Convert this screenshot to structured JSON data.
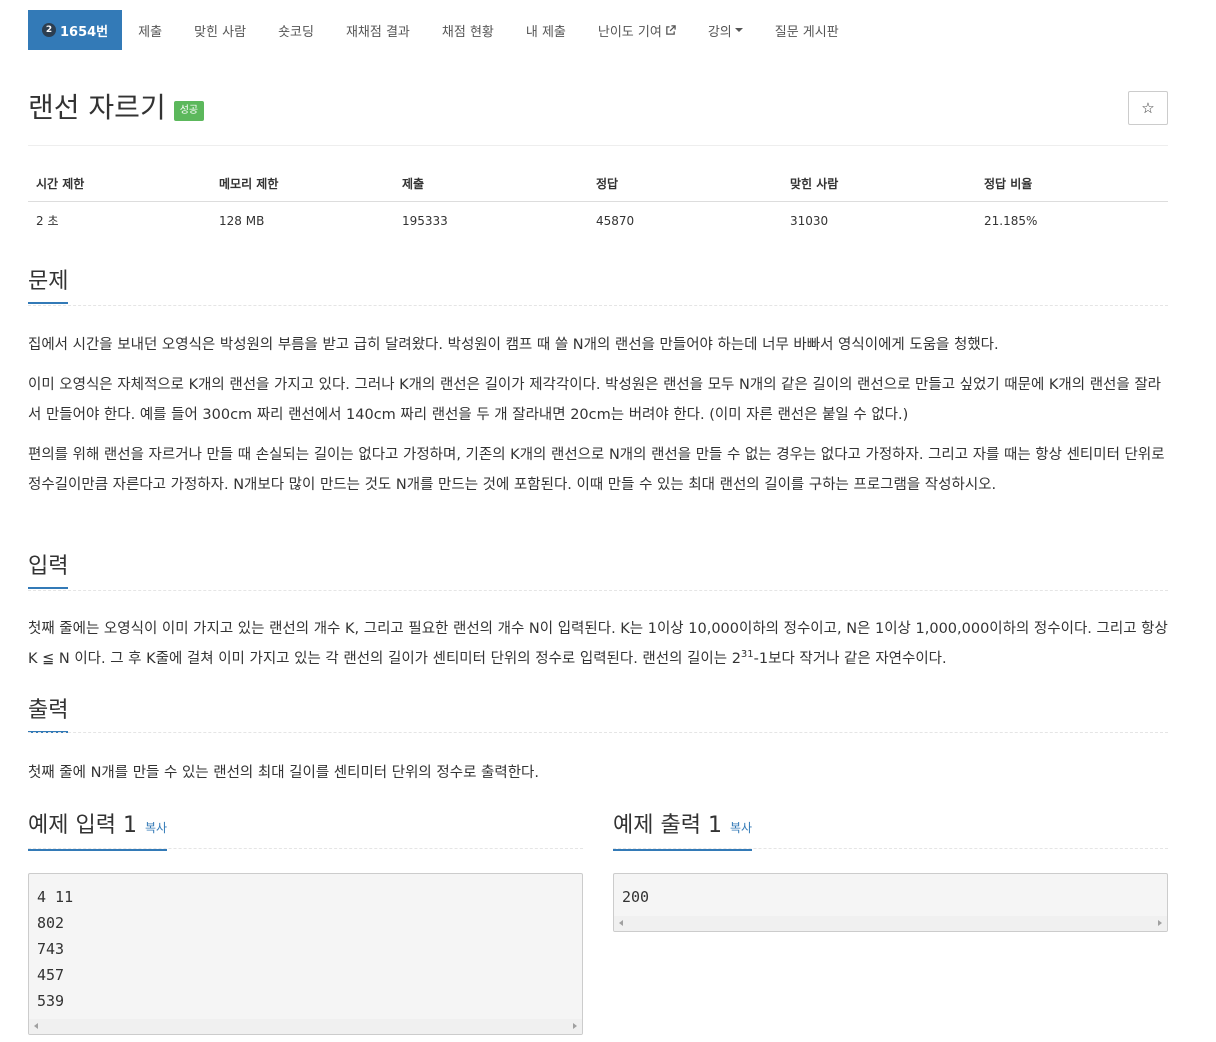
{
  "nav": {
    "problem_number": "1654번",
    "problem_badge": "2",
    "items": [
      {
        "label": "제출"
      },
      {
        "label": "맞힌 사람"
      },
      {
        "label": "숏코딩"
      },
      {
        "label": "재채점 결과"
      },
      {
        "label": "채점 현황"
      },
      {
        "label": "내 제출"
      },
      {
        "label": "난이도 기여"
      },
      {
        "label": "강의"
      },
      {
        "label": "질문 게시판"
      }
    ]
  },
  "problem": {
    "title": "랜선 자르기",
    "status": "성공",
    "star": "☆"
  },
  "stats": {
    "headers": [
      "시간 제한",
      "메모리 제한",
      "제출",
      "정답",
      "맞힌 사람",
      "정답 비율"
    ],
    "values": [
      "2 초",
      "128 MB",
      "195333",
      "45870",
      "31030",
      "21.185%"
    ]
  },
  "sections": {
    "problem_heading": "문제",
    "problem_p1": "집에서 시간을 보내던 오영식은 박성원의 부름을 받고 급히 달려왔다. 박성원이 캠프 때 쓸 N개의 랜선을 만들어야 하는데 너무 바빠서 영식이에게 도움을 청했다.",
    "problem_p2": "이미 오영식은 자체적으로 K개의 랜선을 가지고 있다. 그러나 K개의 랜선은 길이가 제각각이다. 박성원은 랜선을 모두 N개의 같은 길이의 랜선으로 만들고 싶었기 때문에 K개의 랜선을 잘라서 만들어야 한다. 예를 들어 300cm 짜리 랜선에서 140cm 짜리 랜선을 두 개 잘라내면 20cm는 버려야 한다. (이미 자른 랜선은 붙일 수 없다.)",
    "problem_p3": "편의를 위해 랜선을 자르거나 만들 때 손실되는 길이는 없다고 가정하며, 기존의 K개의 랜선으로 N개의 랜선을 만들 수 없는 경우는 없다고 가정하자. 그리고 자를 때는 항상 센티미터 단위로 정수길이만큼 자른다고 가정하자. N개보다 많이 만드는 것도 N개를 만드는 것에 포함된다. 이때 만들 수 있는 최대 랜선의 길이를 구하는 프로그램을 작성하시오.",
    "input_heading": "입력",
    "input_p1": "첫째 줄에는 오영식이 이미 가지고 있는 랜선의 개수 K, 그리고 필요한 랜선의 개수 N이 입력된다. K는 1이상 10,000이하의 정수이고, N은 1이상 1,000,000이하의 정수이다. 그리고 항상 K ≦ N 이다. 그 후 K줄에 걸쳐 이미 가지고 있는 각 랜선의 길이가 센티미터 단위의 정수로 입력된다. 랜선의 길이는 2",
    "input_sup": "31",
    "input_p1_tail": "-1보다 작거나 같은 자연수이다.",
    "output_heading": "출력",
    "output_p1": "첫째 줄에 N개를 만들 수 있는 랜선의 최대 길이를 센티미터 단위의 정수로 출력한다."
  },
  "samples": {
    "input_heading": "예제 입력 1",
    "output_heading": "예제 출력 1",
    "copy_label": "복사",
    "input_text": "4 11\n802\n743\n457\n539",
    "output_text": "200"
  }
}
